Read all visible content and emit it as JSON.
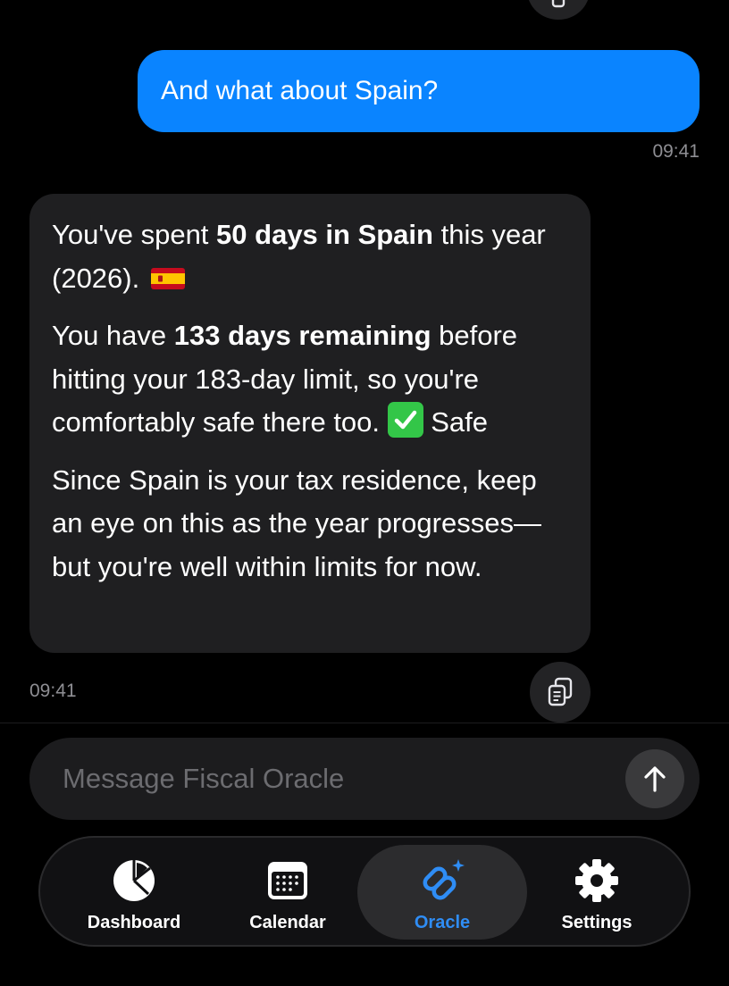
{
  "chat": {
    "user_message": {
      "text": "And what about Spain?",
      "time": "09:41"
    },
    "assistant_message": {
      "p1_a": "You've spent ",
      "p1_b": "50 days in Spain",
      "p1_c": " this year (2026). ",
      "p2_a": "You have ",
      "p2_b": "133 days remaining",
      "p2_c": " before hitting your 183-day limit, so you're comfortably safe there too. ",
      "p2_d": " Safe",
      "p3": "Since Spain is your tax residence, keep an eye on this as the year progresses—but you're well within limits for now.",
      "time": "09:41",
      "flag_icon": "spain-flag-icon",
      "status_icon": "check-mark-icon"
    }
  },
  "composer": {
    "placeholder": "Message Fiscal Oracle",
    "value": "",
    "send_icon": "arrow-up-icon"
  },
  "tabs": [
    {
      "label": "Dashboard",
      "icon": "pie-chart-icon",
      "active": false
    },
    {
      "label": "Calendar",
      "icon": "calendar-icon",
      "active": false
    },
    {
      "label": "Oracle",
      "icon": "oracle-sparkle-icon",
      "active": true
    },
    {
      "label": "Settings",
      "icon": "gear-icon",
      "active": false
    }
  ],
  "colors": {
    "background": "#000000",
    "user_bubble": "#0a84ff",
    "assistant_bubble": "#1f1f21",
    "accent": "#2f8df5",
    "check_green": "#33c648"
  }
}
